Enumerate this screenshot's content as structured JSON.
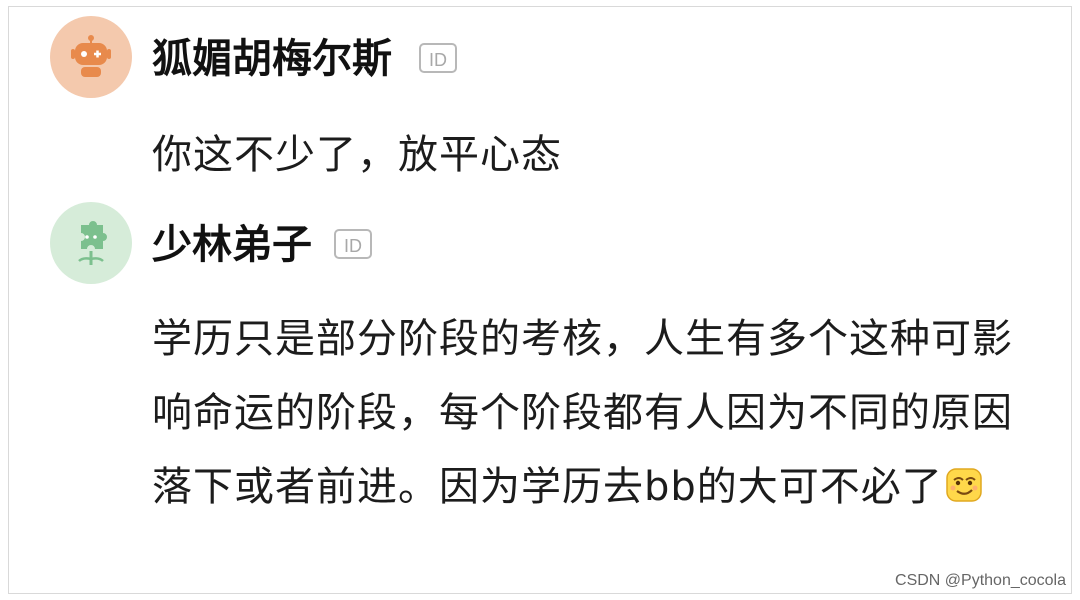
{
  "comments": [
    {
      "username": "狐媚胡梅尔斯",
      "id_badge": "ID",
      "avatar_icon": "robot-avatar-icon",
      "avatar_color": "#f4c9ad",
      "text": "你这不少了，放平心态"
    },
    {
      "username": "少林弟子",
      "id_badge": "ID",
      "avatar_icon": "puzzle-plant-avatar-icon",
      "avatar_color": "#d6ecd9",
      "text": "学历只是部分阶段的考核，人生有多个这种可影响命运的阶段，每个阶段都有人因为不同的原因落下或者前进。因为学历去bb的大可不必了",
      "trailing_emoji": "smirk-face-emoji"
    }
  ],
  "watermark": "CSDN @Python_cocola"
}
